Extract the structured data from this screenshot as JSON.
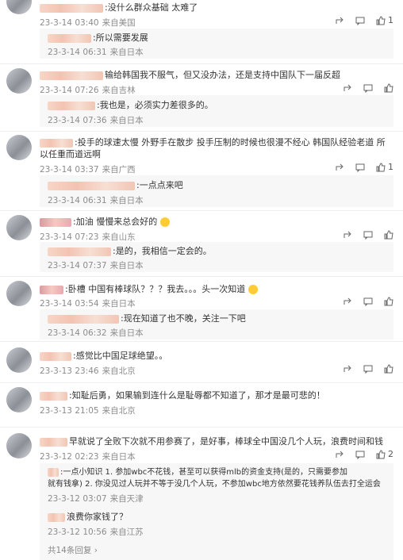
{
  "c1": {
    "text": ":没什么群众基础 太难了",
    "time": "23-3-14 03:40",
    "loc": "来自美国",
    "likes": "1"
  },
  "c1r": {
    "text": ":所以需要发展",
    "time": "23-3-14 06:31",
    "loc": "来自日本"
  },
  "c2": {
    "text": "输给韩国我不服气，但又没办法，还是支持中国队下一届反超",
    "time": "23-3-14 07:26",
    "loc": "来自吉林"
  },
  "c2r": {
    "text": ":我也是，必须实力差很多的。",
    "time": "23-3-14 07:36",
    "loc": "来自日本"
  },
  "c3": {
    "text1": ":投手的球速太慢 外野手在散步 投手压制的时候也很漫不经心 韩国队经验老道 所",
    "text2": "以任重而道远啊",
    "time": "23-3-14 03:37",
    "loc": "来自广西",
    "likes": "1"
  },
  "c3r": {
    "text": ":一点点来吧",
    "time": "23-3-14 06:31",
    "loc": "来自日本"
  },
  "c4": {
    "text": ":加油 慢慢来总会好的",
    "time": "23-3-14 07:23",
    "loc": "来自山东"
  },
  "c4r": {
    "text": ":是的，我相信一定会的。",
    "time": "23-3-14 07:37",
    "loc": "来自日本"
  },
  "c5": {
    "text": ":卧槽 中国有棒球队？？？我去。。。头一次知道",
    "time": "23-3-14 03:54",
    "loc": "来自日本"
  },
  "c5r": {
    "text": ":现在知道了也不晚，关注一下吧",
    "time": "23-3-14 06:32",
    "loc": "来自日本"
  },
  "c6": {
    "text": ":感觉比中国足球绝望。。",
    "time": "23-3-13 23:46",
    "loc": "来自北京"
  },
  "c7": {
    "text": ":知耻后勇，如果输到连什么是耻辱都不知道了，那才是最可悲的！",
    "time": "23-3-13 21:05",
    "loc": "来自北京"
  },
  "c8": {
    "text": "早就说了全败下次就不用参赛了，是好事，棒球全中国没几个人玩，浪费时间和钱",
    "time": "23-3-12 02:23",
    "loc": "来自日本",
    "likes": "2"
  },
  "c8r1": {
    "text1": ":一点小知识 1. 参加wbc不花钱，甚至可以获得mlb的资金支持(是的，只需要参加",
    "text2": "就有钱拿) 2. 你没见过人玩并不等于没几个人玩，不参加wbc地方依然要花钱养队伍去打全运会",
    "time": "23-3-12 03:07",
    "loc": "来自天津"
  },
  "c8r2": {
    "text": "浪费你家钱了？",
    "time": "23-3-12 10:56",
    "loc": "来自江苏"
  },
  "more": "共14条回复"
}
